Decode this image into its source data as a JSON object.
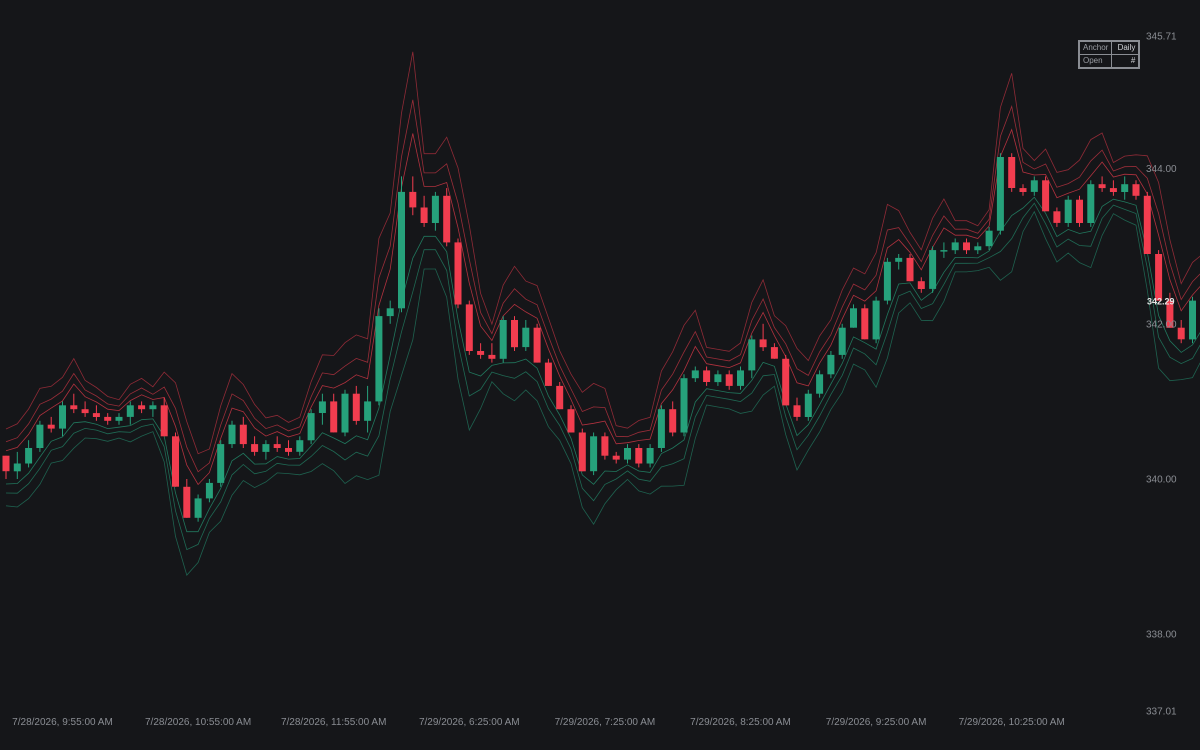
{
  "colors": {
    "background": "#151619",
    "up": "#26a17b",
    "down": "#f23d4f",
    "text": "#8a8d93"
  },
  "legend": [
    {
      "label": "Anchor",
      "value": "Daily"
    },
    {
      "label": "Open",
      "value": "#"
    }
  ],
  "chart_data": {
    "type": "candlestick",
    "title": "",
    "ylim": [
      337.01,
      345.71
    ],
    "y_ticks": [
      "345.71",
      "344.00",
      "342.00",
      "340.00",
      "338.00",
      "337.01"
    ],
    "last_price": "342.29",
    "x_ticks": [
      {
        "label": "7/28/2026, 9:55:00 AM",
        "index": 5
      },
      {
        "label": "7/28/2026, 10:55:00 AM",
        "index": 17
      },
      {
        "label": "7/28/2026, 11:55:00 AM",
        "index": 29
      },
      {
        "label": "7/29/2026, 6:25:00 AM",
        "index": 41
      },
      {
        "label": "7/29/2026, 7:25:00 AM",
        "index": 53
      },
      {
        "label": "7/29/2026, 8:25:00 AM",
        "index": 65
      },
      {
        "label": "7/29/2026, 9:25:00 AM",
        "index": 77
      },
      {
        "label": "7/29/2026, 10:25:00 AM",
        "index": 89
      }
    ],
    "candles": [
      [
        340.3,
        340.3,
        340.0,
        340.1
      ],
      [
        340.1,
        340.35,
        340.0,
        340.2
      ],
      [
        340.2,
        340.5,
        340.15,
        340.4
      ],
      [
        340.4,
        340.75,
        340.35,
        340.7
      ],
      [
        340.7,
        340.8,
        340.6,
        340.65
      ],
      [
        340.65,
        341.0,
        340.55,
        340.95
      ],
      [
        340.95,
        341.1,
        340.85,
        340.9
      ],
      [
        340.9,
        341.0,
        340.8,
        340.85
      ],
      [
        340.85,
        340.95,
        340.75,
        340.8
      ],
      [
        340.8,
        340.85,
        340.7,
        340.75
      ],
      [
        340.75,
        340.85,
        340.7,
        340.8
      ],
      [
        340.8,
        341.0,
        340.7,
        340.95
      ],
      [
        340.95,
        341.0,
        340.85,
        340.9
      ],
      [
        340.9,
        341.0,
        340.8,
        340.95
      ],
      [
        340.95,
        341.05,
        340.55,
        340.55
      ],
      [
        340.55,
        340.6,
        339.9,
        339.9
      ],
      [
        339.9,
        340.0,
        339.5,
        339.5
      ],
      [
        339.5,
        339.8,
        339.45,
        339.75
      ],
      [
        339.75,
        340.0,
        339.7,
        339.95
      ],
      [
        339.95,
        340.5,
        339.9,
        340.45
      ],
      [
        340.45,
        340.75,
        340.4,
        340.7
      ],
      [
        340.7,
        340.8,
        340.4,
        340.45
      ],
      [
        340.45,
        340.55,
        340.3,
        340.35
      ],
      [
        340.35,
        340.5,
        340.25,
        340.45
      ],
      [
        340.45,
        340.55,
        340.35,
        340.4
      ],
      [
        340.4,
        340.5,
        340.3,
        340.35
      ],
      [
        340.35,
        340.55,
        340.3,
        340.5
      ],
      [
        340.5,
        340.9,
        340.45,
        340.85
      ],
      [
        340.85,
        341.1,
        340.7,
        341.0
      ],
      [
        341.0,
        341.1,
        340.6,
        340.6
      ],
      [
        340.6,
        341.15,
        340.55,
        341.1
      ],
      [
        341.1,
        341.2,
        340.7,
        340.75
      ],
      [
        340.75,
        341.2,
        340.6,
        341.0
      ],
      [
        341.0,
        342.2,
        340.95,
        342.1
      ],
      [
        342.1,
        342.3,
        342.0,
        342.2
      ],
      [
        342.2,
        343.9,
        342.15,
        343.7
      ],
      [
        343.7,
        343.9,
        343.4,
        343.5
      ],
      [
        343.5,
        343.65,
        343.25,
        343.3
      ],
      [
        343.3,
        343.7,
        343.2,
        343.65
      ],
      [
        343.65,
        343.75,
        343.0,
        343.05
      ],
      [
        343.05,
        343.1,
        342.2,
        342.25
      ],
      [
        342.25,
        342.3,
        341.6,
        341.65
      ],
      [
        341.65,
        341.75,
        341.55,
        341.6
      ],
      [
        341.6,
        341.75,
        341.5,
        341.55
      ],
      [
        341.55,
        342.1,
        341.5,
        342.05
      ],
      [
        342.05,
        342.1,
        341.65,
        341.7
      ],
      [
        341.7,
        342.05,
        341.65,
        341.95
      ],
      [
        341.95,
        342.0,
        341.5,
        341.5
      ],
      [
        341.5,
        341.55,
        341.2,
        341.2
      ],
      [
        341.2,
        341.25,
        340.9,
        340.9
      ],
      [
        340.9,
        340.95,
        340.6,
        340.6
      ],
      [
        340.6,
        340.65,
        340.1,
        340.1
      ],
      [
        340.1,
        340.6,
        340.05,
        340.55
      ],
      [
        340.55,
        340.6,
        340.25,
        340.3
      ],
      [
        340.3,
        340.35,
        340.2,
        340.25
      ],
      [
        340.25,
        340.45,
        340.2,
        340.4
      ],
      [
        340.4,
        340.45,
        340.15,
        340.2
      ],
      [
        340.2,
        340.45,
        340.15,
        340.4
      ],
      [
        340.4,
        340.95,
        340.35,
        340.9
      ],
      [
        340.9,
        341.0,
        340.55,
        340.6
      ],
      [
        340.6,
        341.35,
        340.55,
        341.3
      ],
      [
        341.3,
        341.45,
        341.25,
        341.4
      ],
      [
        341.4,
        341.45,
        341.2,
        341.25
      ],
      [
        341.25,
        341.4,
        341.2,
        341.35
      ],
      [
        341.35,
        341.4,
        341.15,
        341.2
      ],
      [
        341.2,
        341.45,
        341.15,
        341.4
      ],
      [
        341.4,
        341.85,
        341.3,
        341.8
      ],
      [
        341.8,
        342.0,
        341.65,
        341.7
      ],
      [
        341.7,
        341.75,
        341.55,
        341.55
      ],
      [
        341.55,
        341.6,
        340.95,
        340.95
      ],
      [
        340.95,
        341.05,
        340.75,
        340.8
      ],
      [
        340.8,
        341.15,
        340.75,
        341.1
      ],
      [
        341.1,
        341.4,
        341.05,
        341.35
      ],
      [
        341.35,
        341.65,
        341.3,
        341.6
      ],
      [
        341.6,
        342.0,
        341.55,
        341.95
      ],
      [
        341.95,
        342.25,
        341.95,
        342.2
      ],
      [
        342.2,
        342.25,
        341.8,
        341.8
      ],
      [
        341.8,
        342.35,
        341.75,
        342.3
      ],
      [
        342.3,
        342.85,
        342.25,
        342.8
      ],
      [
        342.8,
        342.9,
        342.7,
        342.85
      ],
      [
        342.85,
        342.9,
        342.55,
        342.55
      ],
      [
        342.55,
        342.6,
        342.4,
        342.45
      ],
      [
        342.45,
        343.0,
        342.4,
        342.95
      ],
      [
        342.95,
        343.05,
        342.85,
        342.95
      ],
      [
        342.95,
        343.1,
        342.9,
        343.05
      ],
      [
        343.05,
        343.1,
        342.9,
        342.95
      ],
      [
        342.95,
        343.05,
        342.9,
        343.0
      ],
      [
        343.0,
        343.25,
        342.95,
        343.2
      ],
      [
        343.2,
        344.2,
        343.15,
        344.15
      ],
      [
        344.15,
        344.2,
        343.7,
        343.75
      ],
      [
        343.75,
        343.8,
        343.65,
        343.7
      ],
      [
        343.7,
        343.9,
        343.65,
        343.85
      ],
      [
        343.85,
        343.9,
        343.45,
        343.45
      ],
      [
        343.45,
        343.5,
        343.25,
        343.3
      ],
      [
        343.3,
        343.65,
        343.25,
        343.6
      ],
      [
        343.6,
        343.65,
        343.25,
        343.3
      ],
      [
        343.3,
        343.85,
        343.25,
        343.8
      ],
      [
        343.8,
        343.9,
        343.7,
        343.75
      ],
      [
        343.75,
        343.85,
        343.65,
        343.7
      ],
      [
        343.7,
        343.9,
        343.6,
        343.8
      ],
      [
        343.8,
        343.85,
        343.6,
        343.65
      ],
      [
        343.65,
        343.7,
        342.9,
        342.9
      ],
      [
        342.9,
        342.95,
        342.3,
        342.3
      ],
      [
        342.3,
        342.4,
        341.95,
        341.95
      ],
      [
        341.95,
        342.05,
        341.75,
        341.8
      ],
      [
        341.8,
        342.35,
        341.75,
        342.3
      ],
      [
        342.3,
        342.35,
        342.15,
        342.2
      ]
    ]
  }
}
